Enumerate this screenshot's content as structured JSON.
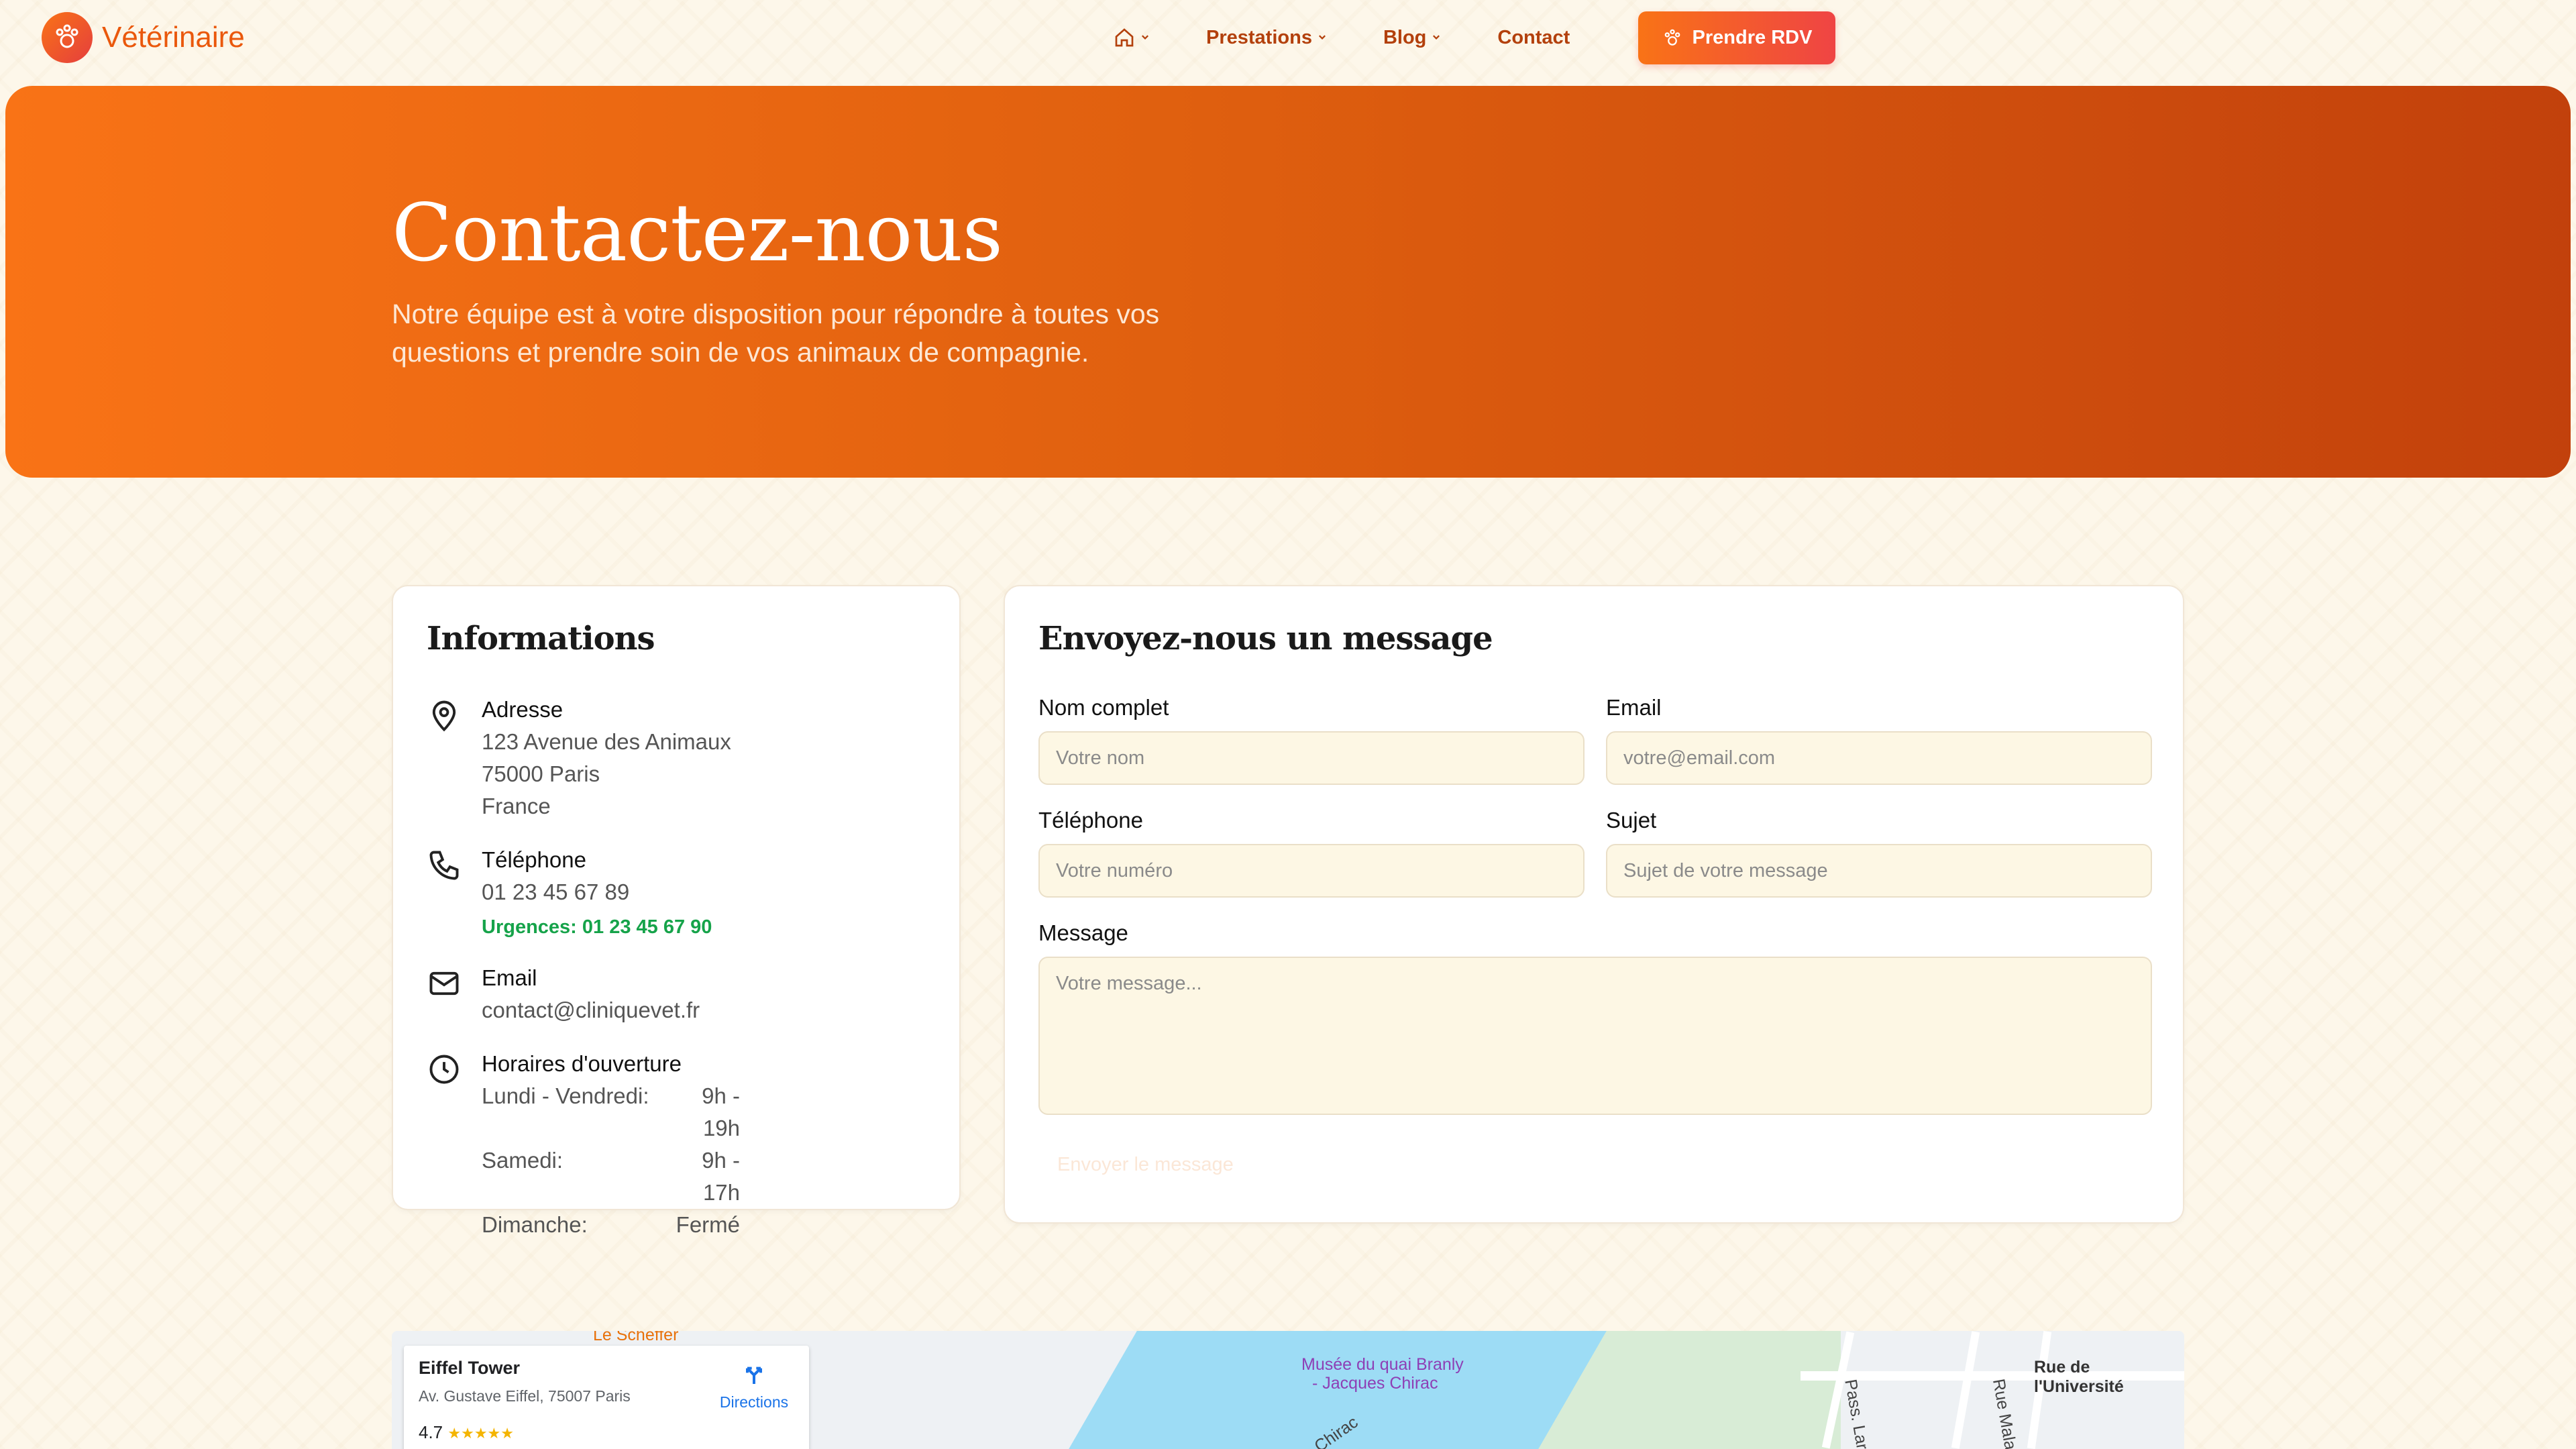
{
  "brand": {
    "name": "Vétérinaire",
    "primary": "#f97316",
    "secondary": "#ef4444",
    "dark": "#c2410c"
  },
  "nav": {
    "home_icon": "home-icon",
    "items": [
      {
        "label": "Prestations"
      },
      {
        "label": "Blog"
      },
      {
        "label": "Contact"
      }
    ],
    "cta_label": "Prendre RDV"
  },
  "hero": {
    "title": "Contactez-nous",
    "subtitle_line1": "Notre équipe est à votre disposition pour répondre à toutes vos",
    "subtitle_line2": "questions et prendre soin de vos animaux de compagnie."
  },
  "info": {
    "title": "Informations",
    "address": {
      "label": "Adresse",
      "line1": "123 Avenue des Animaux",
      "line2": "75000 Paris",
      "line3": "France"
    },
    "phone": {
      "label": "Téléphone",
      "number": "01 23 45 67 89",
      "emergency": "Urgences: 01 23 45 67 90"
    },
    "email": {
      "label": "Email",
      "value": "contact@cliniquevet.fr"
    },
    "hours": {
      "label": "Horaires d'ouverture",
      "rows": [
        {
          "day": "Lundi - Vendredi:",
          "time": "9h - 19h"
        },
        {
          "day": "Samedi:",
          "time": "9h - 17h"
        },
        {
          "day": "Dimanche:",
          "time": "Fermé"
        }
      ]
    }
  },
  "form": {
    "title": "Envoyez-nous un message",
    "name": {
      "label": "Nom complet",
      "placeholder": "Votre nom"
    },
    "email": {
      "label": "Email",
      "placeholder": "votre@email.com"
    },
    "phone": {
      "label": "Téléphone",
      "placeholder": "Votre numéro"
    },
    "subject": {
      "label": "Sujet",
      "placeholder": "Sujet de votre message"
    },
    "message": {
      "label": "Message",
      "placeholder": "Votre message..."
    },
    "submit_label": "Envoyer le message"
  },
  "map": {
    "place_name": "Eiffel Tower",
    "place_address": "Av. Gustave Eiffel, 75007 Paris",
    "rating": "4.7",
    "stars": "★★★★★",
    "directions_label": "Directions",
    "label_scheffer": "Le Scheffer",
    "label_museum_1": "Musée du quai Branly",
    "label_museum_2": "- Jacques Chirac",
    "label_universite": "Rue de l'Université",
    "label_chirac": "Chirac",
    "label_pass": "Pass. Lar",
    "label_rue_mala": "Rue Mala"
  }
}
